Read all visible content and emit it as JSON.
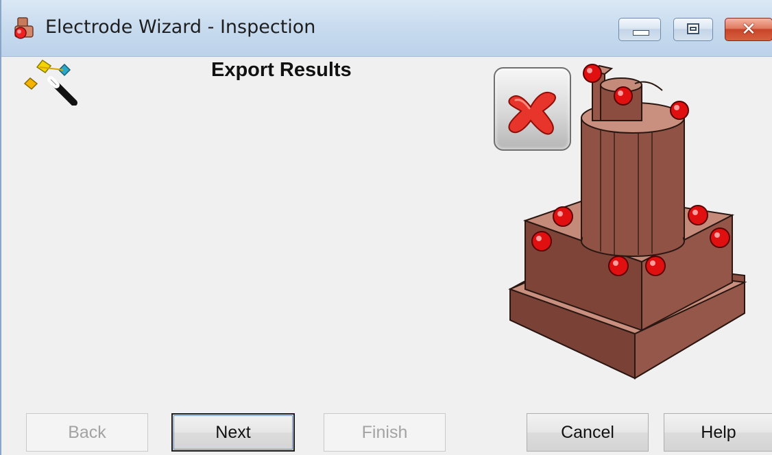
{
  "window": {
    "title": "Electrode Wizard - Inspection"
  },
  "icons": {
    "app": "electrode-wizard-app-icon",
    "wizard": "wand-icon",
    "status": "fail-x-icon",
    "illustration": "electrode-with-inspection-points"
  },
  "page": {
    "heading": "Export Results"
  },
  "buttons": {
    "back": "Back",
    "next": "Next",
    "finish": "Finish",
    "cancel": "Cancel",
    "help": "Help"
  },
  "colors": {
    "status_x": "#e8352b",
    "electrode": "#9b5a4c",
    "inspection_point": "#e01010"
  }
}
